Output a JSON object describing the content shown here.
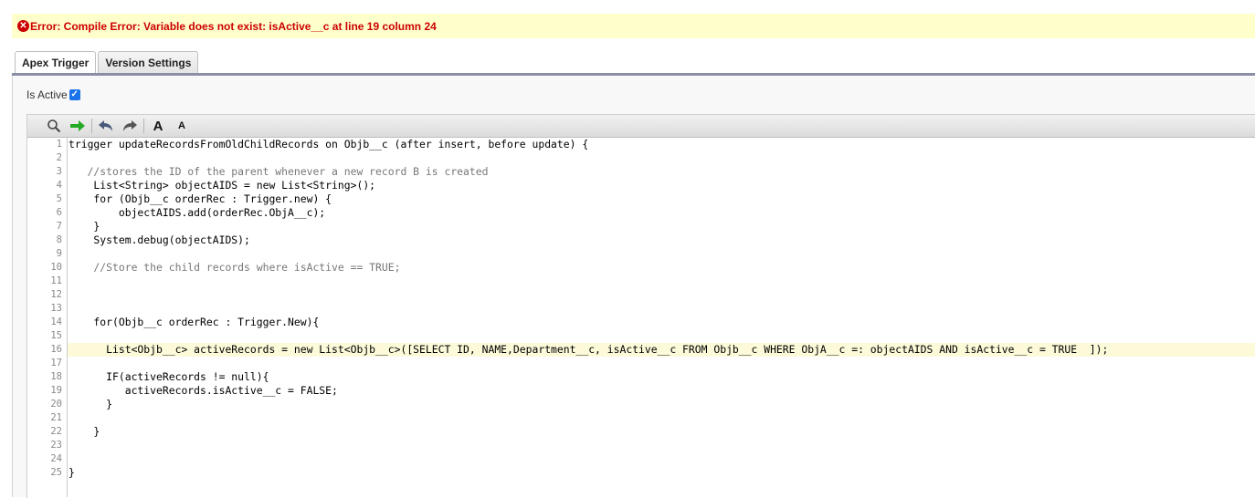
{
  "error": {
    "message": "Error: Compile Error: Variable does not exist: isActive__c at line 19 column 24",
    "icon": "error-circle-icon"
  },
  "tabs": [
    {
      "label": "Apex Trigger",
      "active": true
    },
    {
      "label": "Version Settings",
      "active": false
    }
  ],
  "is_active": {
    "label": "Is Active",
    "checked": true
  },
  "toolbar": {
    "search_icon": "search-icon",
    "goto_icon": "goto-arrow-icon",
    "undo_icon": "undo-icon",
    "redo_icon": "redo-icon",
    "font_increase": "A",
    "font_decrease": "A"
  },
  "editor": {
    "highlighted_line": 16,
    "lines": [
      "trigger updateRecordsFromOldChildRecords on Objb__c (after insert, before update) {",
      "",
      "   //stores the ID of the parent whenever a new record B is created",
      "    List<String> objectAIDS = new List<String>();",
      "    for (Objb__c orderRec : Trigger.new) {",
      "        objectAIDS.add(orderRec.ObjA__c);",
      "    }",
      "    System.debug(objectAIDS);",
      "",
      "    //Store the child records where isActive == TRUE;",
      "",
      "",
      "",
      "    for(Objb__c orderRec : Trigger.New){",
      "",
      "      List<Objb__c> activeRecords = new List<Objb__c>([SELECT ID, NAME,Department__c, isActive__c FROM Objb__c WHERE ObjA__c =: objectAIDS AND isActive__c = TRUE  ]);",
      "",
      "      IF(activeRecords != null){",
      "         activeRecords.isActive__c = FALSE;",
      "      }",
      "",
      "    }",
      "",
      "",
      "}"
    ]
  }
}
